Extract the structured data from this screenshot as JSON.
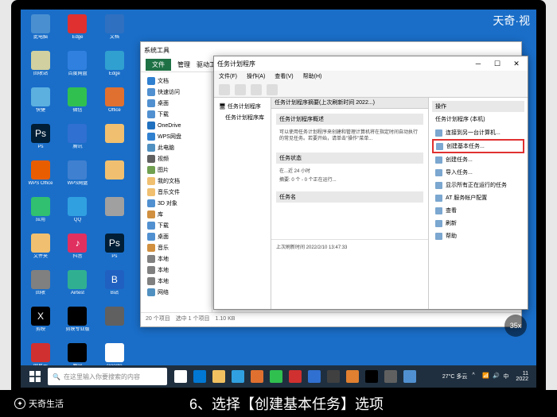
{
  "top_watermark": "天奇·视",
  "desktop_icons": {
    "col1": [
      {
        "label": "此电脑",
        "color": "#4a90d0"
      },
      {
        "label": "回收站",
        "color": "#d0d0a0"
      },
      {
        "label": "快捷",
        "color": "#5bb0e0"
      },
      {
        "label": "Ps",
        "color": "#001e36",
        "text": "Ps"
      },
      {
        "label": "WPS Office",
        "color": "#e85d00"
      },
      {
        "label": "应用",
        "color": "#30c070"
      },
      {
        "label": "文件夹",
        "color": "#f0c070"
      },
      {
        "label": "回收",
        "color": "#808080"
      },
      {
        "label": "剪映",
        "color": "#000",
        "text": "X"
      },
      {
        "label": "网易云",
        "color": "#d03030"
      }
    ],
    "col2": [
      {
        "label": "Edge",
        "color": "#e03030"
      },
      {
        "label": "百度网盘",
        "color": "#3080e0"
      },
      {
        "label": "微信",
        "color": "#30c050"
      },
      {
        "label": "腾讯",
        "color": "#3070d0"
      },
      {
        "label": "WPS网盘",
        "color": "#4080d0"
      },
      {
        "label": "QQ",
        "color": "#30a0e0"
      },
      {
        "label": "抖音",
        "color": "#e03060",
        "text": "♪"
      },
      {
        "label": "Airtest",
        "color": "#30b090"
      },
      {
        "label": "剪映专业版",
        "color": "#000"
      },
      {
        "label": "腾讯",
        "color": "#000"
      }
    ],
    "col3": [
      {
        "label": "文档",
        "color": "#3070c0"
      },
      {
        "label": "Edge",
        "color": "#30a0d0"
      },
      {
        "label": "Office",
        "color": "#e07030"
      },
      {
        "label": "",
        "color": "#f0c070"
      },
      {
        "label": "",
        "color": "#f0c070"
      },
      {
        "label": "",
        "color": "#a0a0a0"
      },
      {
        "label": "Ps",
        "color": "#001e36",
        "text": "Ps"
      },
      {
        "label": "B站",
        "color": "#2060c0",
        "text": "B"
      },
      {
        "label": "",
        "color": "#606060"
      },
      {
        "label": "Google",
        "color": "#fff"
      }
    ]
  },
  "explorer": {
    "title": "系统工具",
    "tab_file": "文件",
    "tabs": [
      "管理",
      "驱动工具"
    ],
    "sidebar": [
      {
        "label": "文档",
        "color": "#3080d0"
      },
      {
        "label": "快速访问",
        "color": "#5090d0"
      },
      {
        "label": "桌面",
        "color": "#5090d0"
      },
      {
        "label": "下载",
        "color": "#5090d0"
      },
      {
        "label": "OneDrive",
        "color": "#2070c0"
      },
      {
        "label": "WPS网盘",
        "color": "#3080d0"
      },
      {
        "label": "此电脑",
        "color": "#5090c0"
      },
      {
        "label": "视频",
        "color": "#606060"
      },
      {
        "label": "图片",
        "color": "#70a050"
      },
      {
        "label": "我的文档",
        "color": "#f0c070"
      },
      {
        "label": "音乐文件",
        "color": "#f0c070"
      },
      {
        "label": "3D 对象",
        "color": "#5090d0"
      },
      {
        "label": "库",
        "color": "#d09040"
      },
      {
        "label": "下载",
        "color": "#5090d0"
      },
      {
        "label": "桌面",
        "color": "#5090d0"
      },
      {
        "label": "音乐",
        "color": "#d09040"
      },
      {
        "label": "本地",
        "color": "#808080"
      },
      {
        "label": "本地",
        "color": "#808080"
      },
      {
        "label": "本地",
        "color": "#808080"
      },
      {
        "label": "网络",
        "color": "#5090c0"
      }
    ],
    "status": "20 个项目　选中 1 个项目　1.10 KB"
  },
  "scheduler": {
    "title": "任务计划程序",
    "menu": [
      "文件(F)",
      "操作(A)",
      "查看(V)",
      "帮助(H)"
    ],
    "tree_root": "任务计划程序",
    "tree_items": [
      "任务计划程序库"
    ],
    "main_header": "任务计划程序摘要(上次刷新时间 2022...)",
    "overview_title": "任务计划程序概述",
    "overview_text": "可以使用任务计划程序来创建和管理计算机将在指定时间自动执行的常见任务。若要开始，请单击\"操作\"菜单...",
    "status_title": "任务状态",
    "status_rows": [
      "在...近 24 小时",
      "摘要: 0 个 - 0 个正在运行..."
    ],
    "taskname_label": "任务名",
    "refresh_info": "上次刷新时间 2022/2/10 13:47:33",
    "actions_header": "操作",
    "actions_sub": "任务计划程序 (本机)",
    "action_items": [
      "连接到另一台计算机...",
      "创建基本任务...",
      "创建任务...",
      "导入任务...",
      "显示所有正在运行的任务",
      "AT 服务帐户配置",
      "查看",
      "刷新",
      "帮助"
    ]
  },
  "taskbar": {
    "search_placeholder": "在这里输入你要搜索的内容",
    "weather": "27°C 多云",
    "time": "11",
    "date": "2022"
  },
  "circle_badge": "35x",
  "bottom_overlay": {
    "logo_text": "天奇生活",
    "caption": "6、选择【创建基本任务】选项"
  }
}
